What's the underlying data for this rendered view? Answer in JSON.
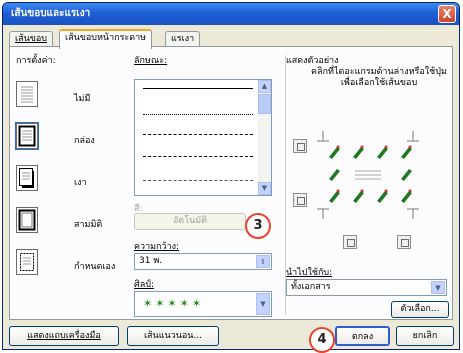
{
  "window": {
    "title": "เส้นขอบและแรเงา",
    "close_glyph": "X"
  },
  "tabs": [
    {
      "label": "เส้นขอบ",
      "active": false
    },
    {
      "label": "เส้นขอบหน้ากระดาษ",
      "active": true
    },
    {
      "label": "แรเงา",
      "active": false
    }
  ],
  "setting": {
    "label": "การตั้งค่า:",
    "options": [
      {
        "label": "ไม่มี"
      },
      {
        "label": "กล่อง"
      },
      {
        "label": "เงา"
      },
      {
        "label": "สามมิติ"
      },
      {
        "label": "กำหนดเอง"
      }
    ]
  },
  "style": {
    "label": "ลักษณะ:"
  },
  "color": {
    "label": "สี:",
    "value": "อัตโนมัติ"
  },
  "width": {
    "label": "ความกว้าง:",
    "value": "31 พ."
  },
  "art": {
    "label": "ศิลป์:"
  },
  "preview": {
    "label": "แสดงตัวอย่าง",
    "instruction": "คลิกที่ไดอะแกรมด้านล่างหรือใช้ปุ่มเพื่อเลือกใช้เส้นขอบ"
  },
  "apply_to": {
    "label": "นำไปใช้กับ:",
    "value": "ทั้งเอกสาร"
  },
  "options_button": "ตัวเลือก...",
  "footer": {
    "toolbar_button": "แสดงแถบเครื่องมือ",
    "hline_button": "เส้นแนวนอน...",
    "ok_button": "ตกลง",
    "cancel_button": "ยกเลิก"
  },
  "callouts": {
    "three": "3",
    "four": "4"
  },
  "colors": {
    "title_bar": "#1f5fd6",
    "callout_border": "#e8442c",
    "dialog_bg": "#ece9d8"
  }
}
